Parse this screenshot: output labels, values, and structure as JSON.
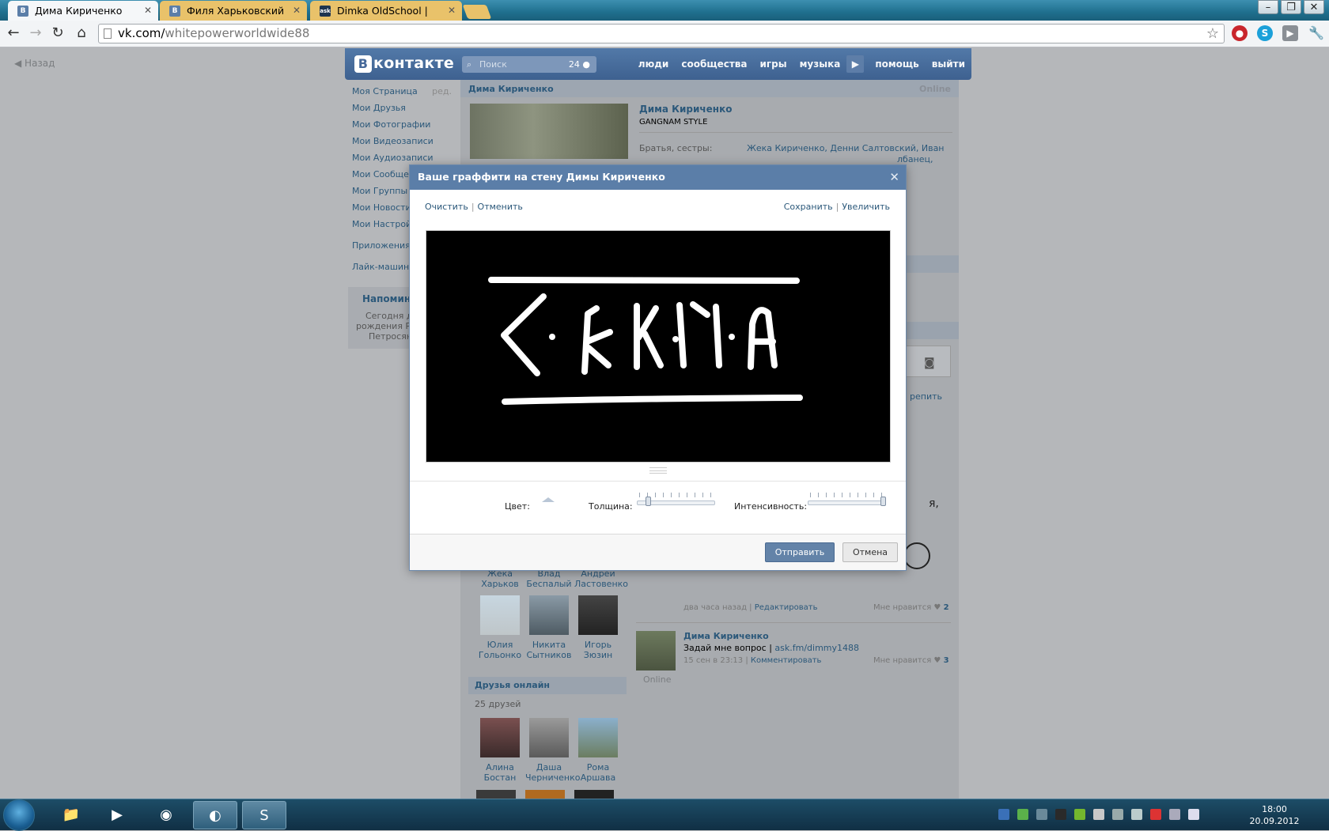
{
  "browser": {
    "tabs": [
      {
        "label": "Дима Кириченко",
        "favicon": "В"
      },
      {
        "label": "Филя Харьковский",
        "favicon": "В"
      },
      {
        "label": "Dimka OldSchool | ask.fm/",
        "favicon": "ask"
      }
    ],
    "url_host": "vk.com/",
    "url_path": "whitepowerworldwide88"
  },
  "vk": {
    "back": "Назад",
    "logo": "контакте",
    "logo_mark": "В",
    "search_placeholder": "Поиск",
    "search_count": "24",
    "nav": [
      "люди",
      "сообщества",
      "игры",
      "музыка",
      "помощь",
      "выйти"
    ],
    "menu": [
      "Моя Страница",
      "Мои Друзья",
      "Мои Фотографии",
      "Мои Видеозаписи",
      "Мои Аудиозаписи",
      "Мои Сообщения",
      "Мои Группы",
      "Мои Новости",
      "Мои Настройки"
    ],
    "menu_edit": "ред.",
    "menu_apps": "Приложения",
    "menu_like": "Лайк-машина",
    "remind_title": "Напомина",
    "remind_lines": [
      "Сегодня д",
      "рождения Ро",
      "Петросян"
    ],
    "profile": {
      "name": "Дима Кириченко",
      "online": "Online",
      "status": "GANGNAM STYLE",
      "siblings_label": "Братья, сестры:",
      "siblings": "Жека Кириченко, Денни Салтовский, Иван",
      "siblings2": "лбанец,"
    },
    "friends": [
      {
        "first": "Жека",
        "last": "Харьков"
      },
      {
        "first": "Влад",
        "last": "Беспалый"
      },
      {
        "first": "Андрей",
        "last": "Ластовенко"
      },
      {
        "first": "Юлия",
        "last": "Гольонко"
      },
      {
        "first": "Никита",
        "last": "Сытников"
      },
      {
        "first": "Игорь",
        "last": "Зюзин"
      }
    ],
    "friends_online_title": "Друзья онлайн",
    "friends_online_count": "25 друзей",
    "online_friends": [
      {
        "first": "Алина",
        "last": "Бостан"
      },
      {
        "first": "Даша",
        "last": "Черниченко"
      },
      {
        "first": "Рома",
        "last": "Аршава"
      }
    ],
    "wall": {
      "fragment_text": "я,",
      "attach": "репить",
      "post1_time": "два часа назад",
      "post1_edit": "Редактировать",
      "post1_likes_label": "Мне нравится",
      "post1_likes": "2",
      "post2_name": "Дима Кириченко",
      "post2_text": "Задай мне вопрос | ",
      "post2_link": "ask.fm/dimmy1488",
      "post2_time": "15 сен в 23:13",
      "post2_comment": "Комментировать",
      "post2_likes_label": "Мне нравится",
      "post2_likes": "3",
      "post2_online": "Online"
    }
  },
  "modal": {
    "title": "Ваше граффити на стену Димы Кириченко",
    "clear": "Очистить",
    "undo": "Отменить",
    "save": "Сохранить",
    "zoom": "Увеличить",
    "color_label": "Цвет:",
    "thickness_label": "Толщина:",
    "intensity_label": "Интенсивность:",
    "thickness_value": 0.1,
    "intensity_value": 1.0,
    "send": "Отправить",
    "cancel": "Отмена",
    "canvas_color": "#000000",
    "stroke_color": "#ffffff"
  },
  "taskbar": {
    "time": "18:00",
    "date": "20.09.2012"
  }
}
